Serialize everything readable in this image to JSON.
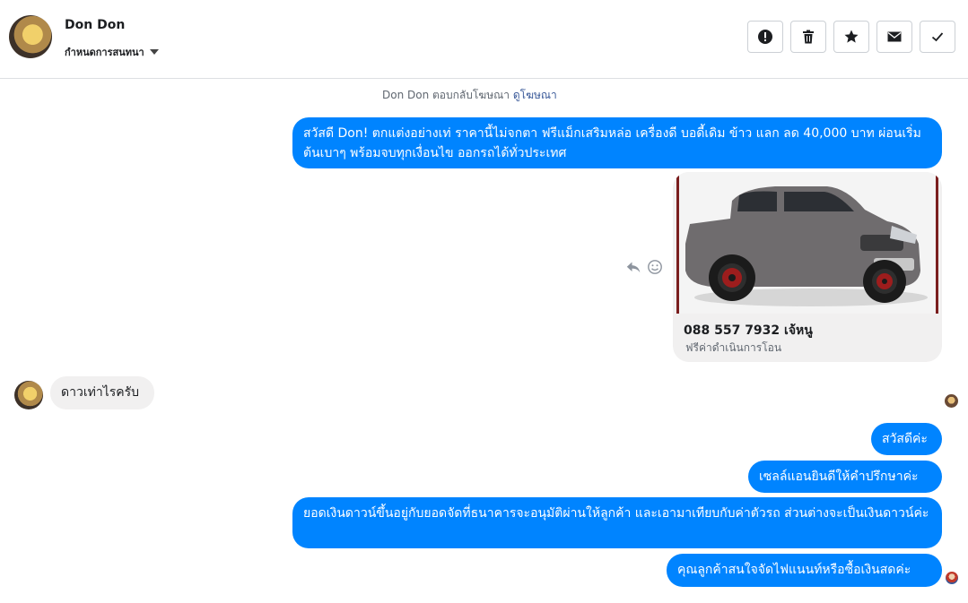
{
  "header": {
    "contact_name": "Don Don",
    "assign_label": "กำหนดการสนทนา",
    "actions": [
      {
        "name": "report",
        "icon": "exclamation-icon"
      },
      {
        "name": "delete",
        "icon": "trash-icon"
      },
      {
        "name": "star",
        "icon": "star-icon"
      },
      {
        "name": "mark-unread",
        "icon": "envelope-icon"
      },
      {
        "name": "mark-done",
        "icon": "checkmark-icon"
      }
    ]
  },
  "conversation": {
    "system_note": "Don Don ตอบกลับโฆษณา",
    "system_link": "ดูโฆษณา",
    "ad_message": "สวัสดี Don! ตกแต่งอย่างเท่ ราคานี้ไม่จกตา ฟรีแม็กเสริมหล่อ เครื่องดี บอดี้เดิม ข้าว แลก ลด 40,000 บาท ผ่อนเริ่มต้นเบาๆ พร้อมจบทุกเงื่อนไข ออกรถได้ทั่วประเทศ",
    "card": {
      "title": "088 557 7932 เจ้หนู",
      "subtitle": "ฟรีค่าดำเนินการโอน",
      "image": "grey-pickup-truck"
    },
    "incoming": "ดาวเท่าไรครับ",
    "replies": [
      "สวัสดีค่ะ",
      "เซลล์แอนยินดีให้คำปรึกษาค่ะ",
      "ยอดเงินดาวน์ขึ้นอยู่กับยอดจัดที่ธนาคารจะอนุมัติผ่านให้ลูกค้า และเอามาเทียบกับค่าตัวรถ ส่วนต่างจะเป็นเงินดาวน์ค่ะ",
      "คุณลูกค้าสนใจจัดไฟแนนท์หรือซื้อเงินสดค่ะ"
    ]
  },
  "colors": {
    "outgoing_bubble": "#0084ff",
    "incoming_bubble": "#f1f0f0",
    "link": "#385898"
  }
}
